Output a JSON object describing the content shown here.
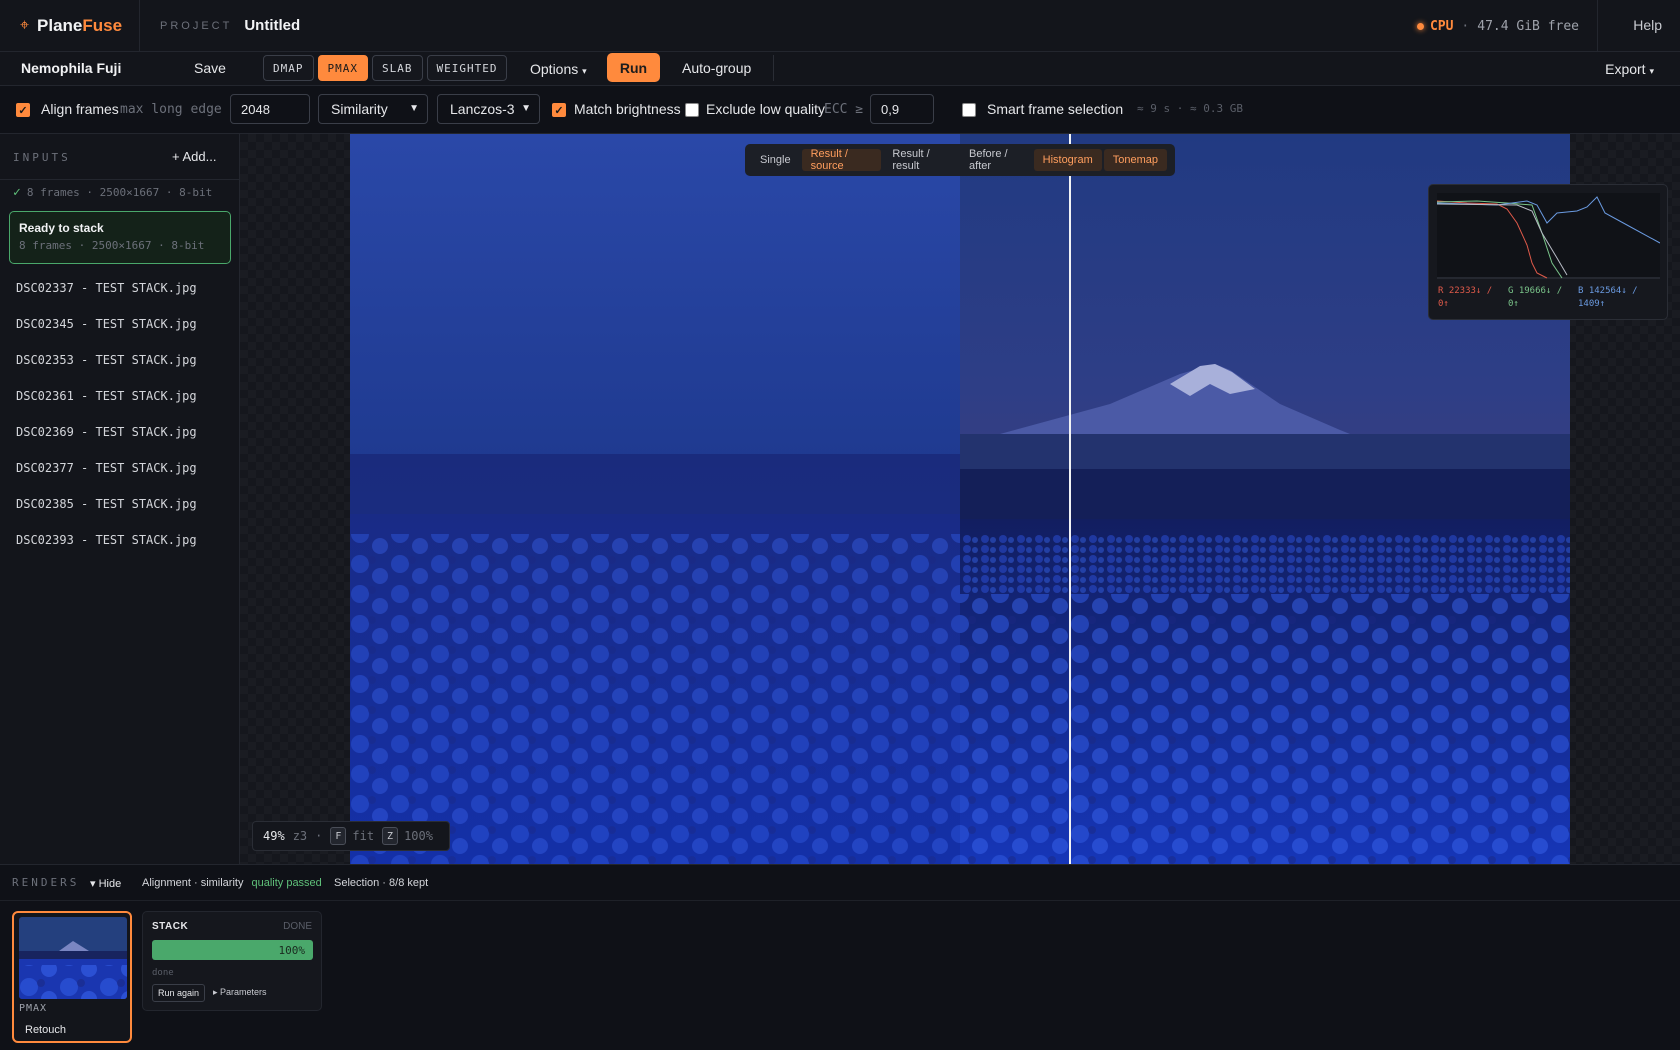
{
  "app": {
    "logo_icon": "crosshair-icon",
    "name_part1": "Plane",
    "name_part2": "Fuse",
    "project_label": "PROJECT",
    "project_title": "Untitled"
  },
  "status": {
    "cpu_label": "CPU",
    "separator": "·",
    "free_mem": "47.4 GiB free",
    "accent": "#ff8a3d"
  },
  "help_label": "Help",
  "toolbar": {
    "stack_name": "Nemophila Fuji",
    "save_label": "Save",
    "modes": [
      "DMAP",
      "PMAX",
      "SLAB",
      "WEIGHTED"
    ],
    "active_mode": "PMAX",
    "options_label": "Options",
    "run_label": "Run",
    "autogroup_label": "Auto-group",
    "export_label": "Export"
  },
  "options": {
    "align_frames": {
      "checked": true,
      "label": "Align frames"
    },
    "max_edge_label": "max long edge",
    "max_edge_value": "2048",
    "transform_value": "Similarity",
    "resample_value": "Lanczos-3",
    "match_brightness": {
      "checked": true,
      "label": "Match brightness"
    },
    "exclude_low_quality": {
      "checked": false,
      "label": "Exclude low quality"
    },
    "ecc_label": "ECC ≥",
    "ecc_value": "0,9",
    "smart_selection": {
      "checked": false,
      "label": "Smart frame selection"
    },
    "estimate": "≈ 9 s · ≈ 0.3 GB"
  },
  "sidebar": {
    "inputs_label": "INPUTS",
    "add_label": "+ Add...",
    "frames_info": "8 frames · 2500×1667 · 8-bit",
    "ready_title": "Ready to stack",
    "ready_sub": "8 frames · 2500×1667 · 8-bit",
    "files": [
      "DSC02337 - TEST STACK.jpg",
      "DSC02345 - TEST STACK.jpg",
      "DSC02353 - TEST STACK.jpg",
      "DSC02361 - TEST STACK.jpg",
      "DSC02369 - TEST STACK.jpg",
      "DSC02377 - TEST STACK.jpg",
      "DSC02385 - TEST STACK.jpg",
      "DSC02393 - TEST STACK.jpg"
    ]
  },
  "viewer": {
    "view_modes": [
      "Single",
      "Result / source",
      "Result / result",
      "Before / after",
      "Histogram",
      "Tonemap"
    ],
    "active_view": "Result / source",
    "histogram": {
      "r": "R 22333↓ / 0↑",
      "g": "G 19666↓ / 0↑",
      "b": "B 142564↓ / 1409↑",
      "colors": {
        "r": "#e05a4a",
        "g": "#7ac48a",
        "b": "#6a9ae0"
      }
    },
    "zoom": {
      "percent": "49%",
      "level": "z3",
      "sep": "·",
      "fit_key": "F",
      "fit_label": "fit",
      "full_key": "Z",
      "full_label": "100%"
    }
  },
  "renders": {
    "label": "RENDERS",
    "hide_label": "▾ Hide",
    "alignment_info": "Alignment · similarity",
    "quality_status": "quality passed",
    "selection_info": "Selection · 8/8 kept",
    "card": {
      "mode": "PMAX",
      "retouch_label": "Retouch"
    },
    "stack": {
      "title": "STACK",
      "state": "DONE",
      "progress": 100,
      "progress_label": "100%",
      "status_text": "done",
      "run_again_label": "Run again",
      "params_label": "▸ Parameters"
    }
  }
}
